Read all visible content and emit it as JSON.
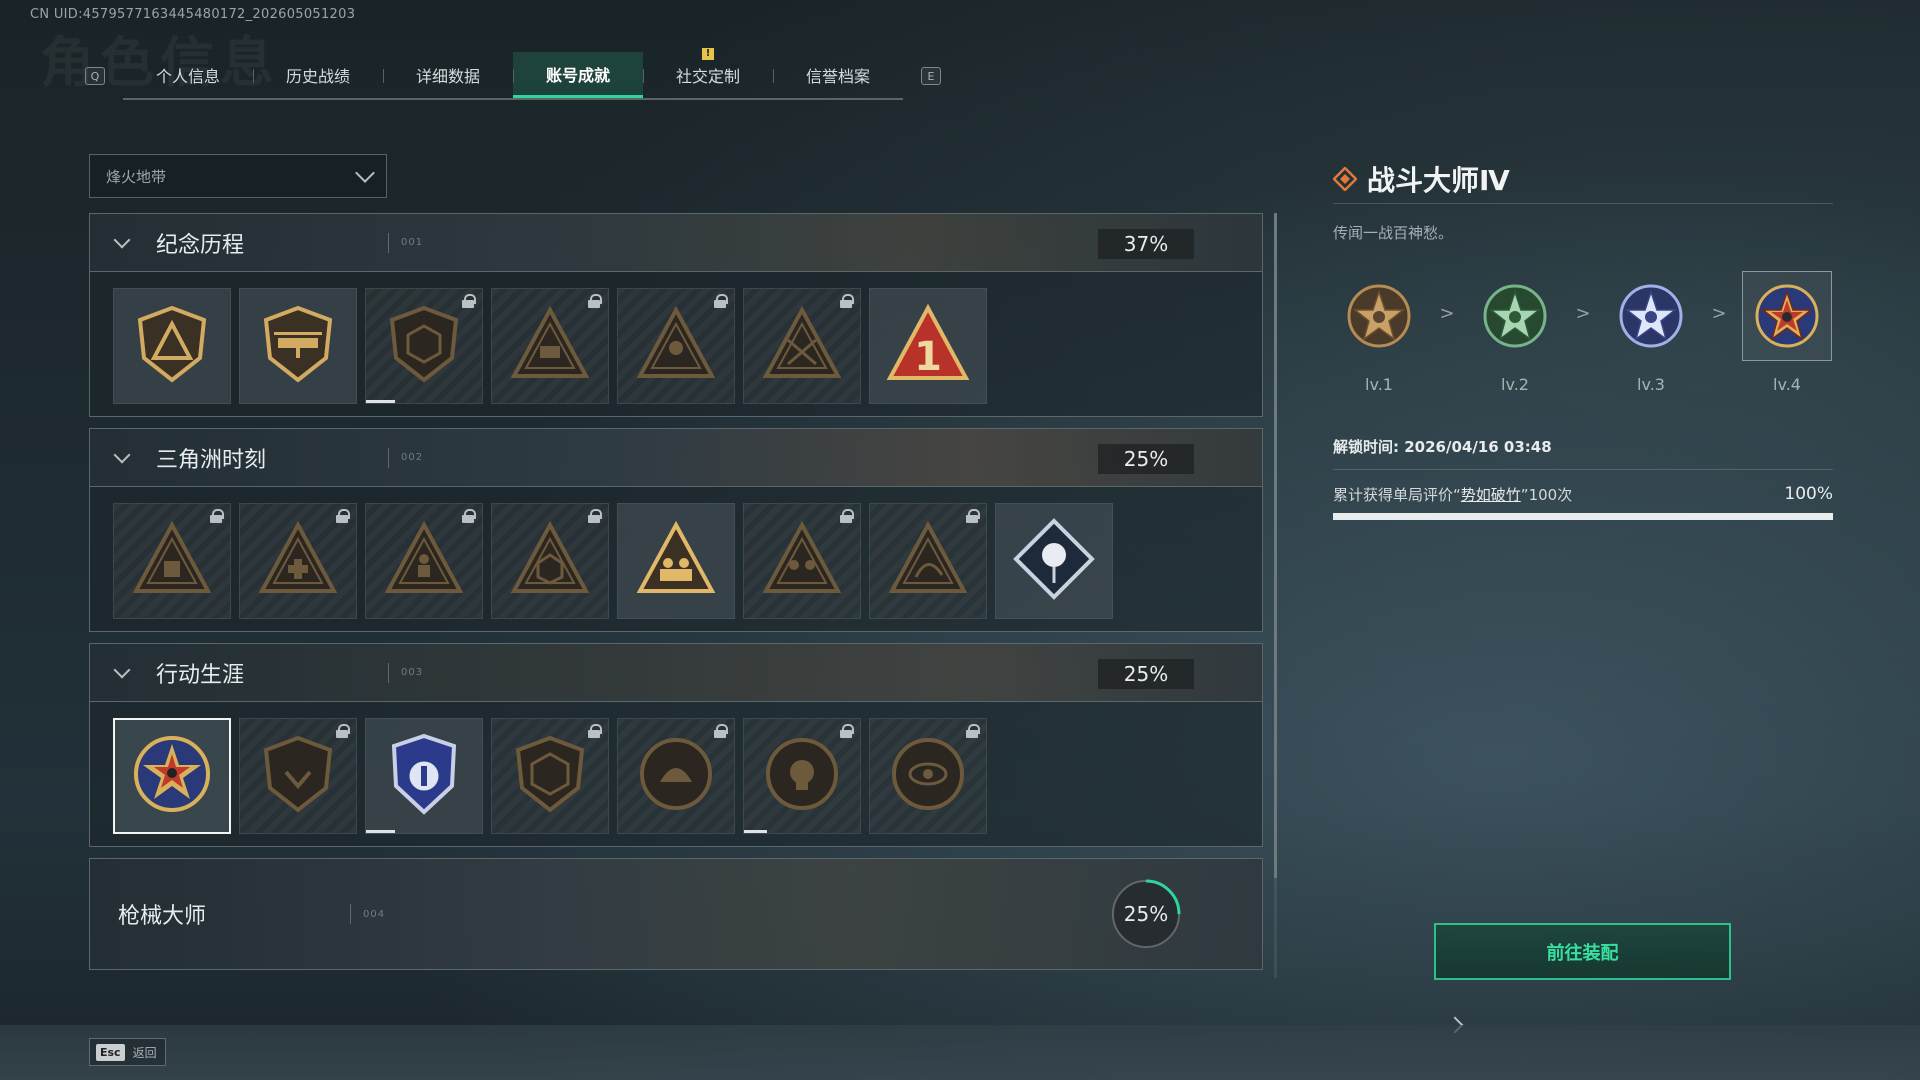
{
  "uid": "CN UID:4579577163445480172_202605051203",
  "tabs": {
    "left_key": "Q",
    "right_key": "E",
    "items": [
      "个人信息",
      "历史战绩",
      "详细数据",
      "账号成就",
      "社交定制",
      "信誉档案"
    ],
    "active_index": 3,
    "alert_tab_index": 4,
    "alert_mark": "!"
  },
  "mode_select": {
    "value": "烽火地带"
  },
  "sections": [
    {
      "title": "纪念历程",
      "code": "001",
      "progress": "37%",
      "badges": [
        {
          "icon": "triangle-emblem-icon",
          "locked": false
        },
        {
          "icon": "helicopter-emblem-icon",
          "locked": false
        },
        {
          "icon": "hex-shield-emblem-icon",
          "locked": true,
          "progress": 0.25
        },
        {
          "icon": "turret-emblem-icon",
          "locked": true
        },
        {
          "icon": "soldier-triangle-emblem-icon",
          "locked": true
        },
        {
          "icon": "crossed-rifles-emblem-icon",
          "locked": true
        },
        {
          "icon": "number-one-triangle-icon",
          "locked": false
        }
      ]
    },
    {
      "title": "三角洲时刻",
      "code": "002",
      "progress": "25%",
      "badges": [
        {
          "icon": "supply-triangle-icon",
          "locked": true
        },
        {
          "icon": "medkit-triangle-icon",
          "locked": true
        },
        {
          "icon": "kneeling-triangle-icon",
          "locked": true
        },
        {
          "icon": "dice-triangle-icon",
          "locked": true
        },
        {
          "icon": "squad-triangle-icon",
          "locked": false
        },
        {
          "icon": "team-triangle-icon",
          "locked": true
        },
        {
          "icon": "dragon-triangle-icon",
          "locked": true
        },
        {
          "icon": "rose-diamond-icon",
          "locked": false
        }
      ]
    },
    {
      "title": "行动生涯",
      "code": "003",
      "progress": "25%",
      "badges": [
        {
          "icon": "star-medal-icon",
          "locked": false,
          "selected": true
        },
        {
          "icon": "shield-medal-icon",
          "locked": true
        },
        {
          "icon": "police-badge-icon",
          "locked": false,
          "progress": 0.25
        },
        {
          "icon": "hex-medal-icon",
          "locked": true
        },
        {
          "icon": "helmet-medal-icon",
          "locked": true
        },
        {
          "icon": "skull-medal-icon",
          "locked": true,
          "progress": 0.2
        },
        {
          "icon": "eye-medal-icon",
          "locked": true
        }
      ]
    }
  ],
  "collapsed_section": {
    "title": "枪械大师",
    "code": "004",
    "progress": "25%",
    "progress_value": 0.25
  },
  "detail": {
    "title": "战斗大师Ⅳ",
    "description": "传闻一战百神愁。",
    "levels": [
      "lv.1",
      "lv.2",
      "lv.3",
      "lv.4"
    ],
    "current_level_index": 3,
    "separator": ">",
    "unlock_time": "解锁时间: 2026/04/16 03:48",
    "requirement_prefix": "累计获得单局评价“",
    "requirement_keyword": "势如破竹",
    "requirement_suffix": "”100次",
    "requirement_pct": "100%",
    "requirement_value": 1.0
  },
  "equip_button": "前往装配",
  "footer": {
    "esc_key": "Esc",
    "back_label": "返回"
  },
  "colors": {
    "accent": "#2fd59a",
    "gold": "#d9b15a",
    "panel_border": "#5a676d"
  }
}
